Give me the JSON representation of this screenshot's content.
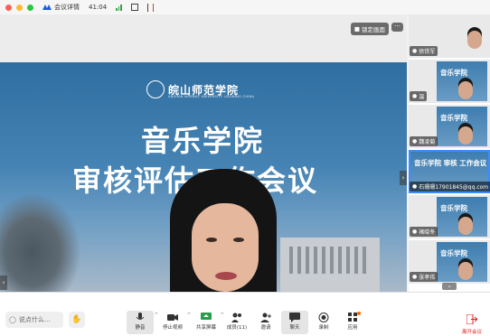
{
  "title_bar": {
    "meeting_label": "会议详情",
    "time": "41:04"
  },
  "main_video": {
    "lock_view_label": "锁定画面",
    "more_label": "···",
    "slide": {
      "university_name": "皖山师范学院",
      "university_english": "ANSHAN NORMAL UNIVERSITY LIAONING CHINA",
      "title_line1": "音乐学院",
      "title_line2": "审核评估工作会议"
    }
  },
  "participants": [
    {
      "name": "徐铁军",
      "has_video": false
    },
    {
      "name": "温",
      "has_video": true
    },
    {
      "name": "魏凌菊",
      "has_video": true
    },
    {
      "name": "石珊珊17901845@qq.com",
      "has_video": true,
      "active": true,
      "slide_text": "音乐学院 审核 工作会议"
    },
    {
      "name": "褚晓冬",
      "has_video": true
    },
    {
      "name": "张孝伟",
      "has_video": true
    }
  ],
  "chat_placeholder": "说点什么...",
  "toolbar": [
    {
      "id": "mute",
      "label": "静音",
      "icon": "mic-icon",
      "selected": true
    },
    {
      "id": "video",
      "label": "停止视频",
      "icon": "camera-icon"
    },
    {
      "id": "share",
      "label": "共享屏幕",
      "icon": "share-screen-icon"
    },
    {
      "id": "members",
      "label": "成员(11)",
      "icon": "members-icon"
    },
    {
      "id": "invite",
      "label": "邀请",
      "icon": "invite-icon"
    },
    {
      "id": "chat",
      "label": "聊天",
      "icon": "chat-icon",
      "selected": true
    },
    {
      "id": "record",
      "label": "录制",
      "icon": "record-icon"
    },
    {
      "id": "apps",
      "label": "应用",
      "icon": "apps-icon"
    }
  ],
  "leave_label": "离开会议",
  "colors": {
    "accent": "#3c8cff",
    "leave": "#e02020",
    "slide_blue": "#2f6ea0"
  }
}
